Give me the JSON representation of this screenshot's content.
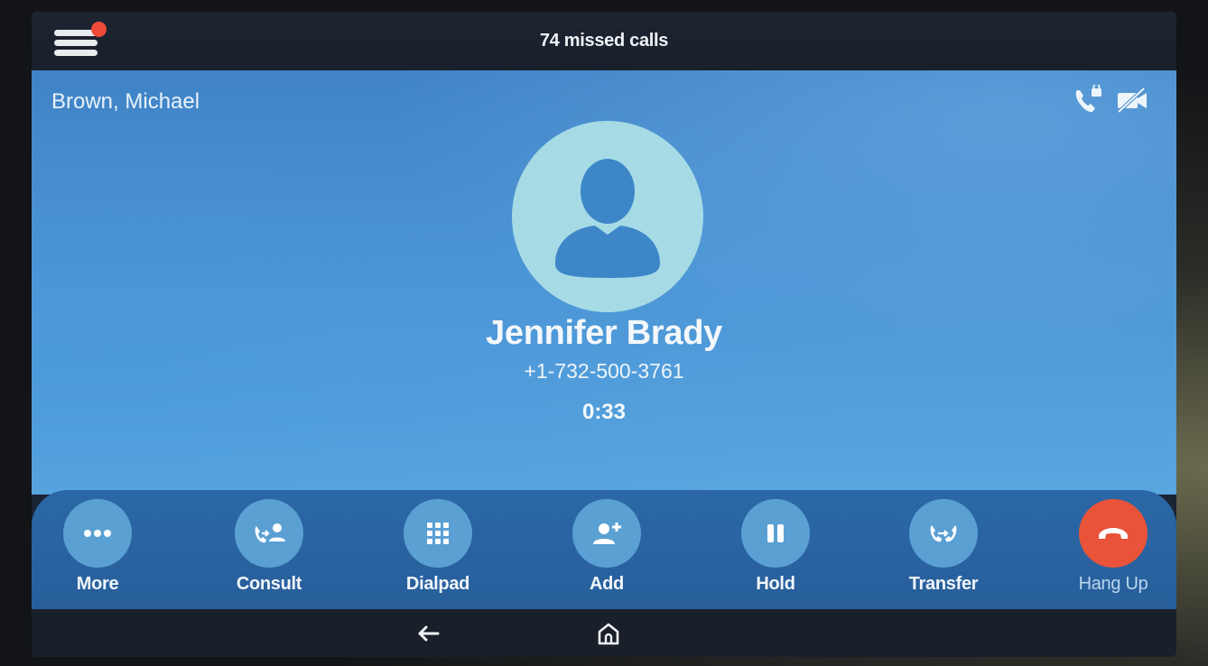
{
  "header": {
    "missed_calls": "74 missed calls",
    "menu_icon": "hamburger-menu-icon",
    "notification_badge_color": "#f04a3a"
  },
  "call": {
    "local_user": "Brown, Michael",
    "caller_name": "Jennifer Brady",
    "caller_number": "+1-732-500-3761",
    "duration": "0:33",
    "status_icons": [
      "phone-lock-icon",
      "video-off-icon"
    ]
  },
  "actions": [
    {
      "label": "More",
      "icon": "more-dots-icon"
    },
    {
      "label": "Consult",
      "icon": "consult-icon"
    },
    {
      "label": "Dialpad",
      "icon": "dialpad-icon"
    },
    {
      "label": "Add",
      "icon": "add-person-icon"
    },
    {
      "label": "Hold",
      "icon": "pause-icon"
    },
    {
      "label": "Transfer",
      "icon": "transfer-icon"
    },
    {
      "label": "Hang Up",
      "icon": "hang-up-icon"
    }
  ],
  "nav": {
    "back_icon": "back-arrow-icon",
    "home_icon": "home-icon"
  },
  "colors": {
    "accent_blue": "#4d96d6",
    "action_bar": "#2b67a6",
    "action_button": "#5aa0d3",
    "hang_up": "#e8533a"
  }
}
